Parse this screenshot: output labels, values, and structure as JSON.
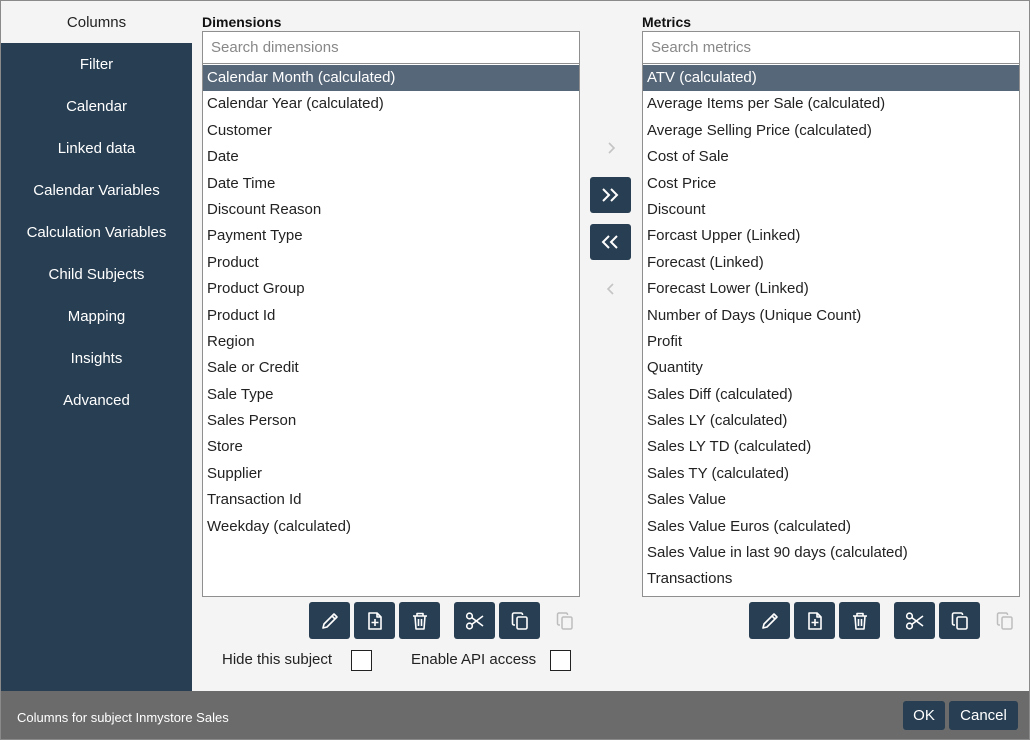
{
  "sidebar": {
    "items": [
      {
        "label": "Columns",
        "active": true
      },
      {
        "label": "Filter"
      },
      {
        "label": "Calendar"
      },
      {
        "label": "Linked data"
      },
      {
        "label": "Calendar Variables"
      },
      {
        "label": "Calculation Variables"
      },
      {
        "label": "Child Subjects"
      },
      {
        "label": "Mapping"
      },
      {
        "label": "Insights"
      },
      {
        "label": "Advanced"
      }
    ]
  },
  "dimensions": {
    "title": "Dimensions",
    "search_placeholder": "Search dimensions",
    "items": [
      "Calendar Month (calculated)",
      "Calendar Year (calculated)",
      "Customer",
      "Date",
      "Date Time",
      "Discount Reason",
      "Payment Type",
      "Product",
      "Product Group",
      "Product Id",
      "Region",
      "Sale or Credit",
      "Sale Type",
      "Sales Person",
      "Store",
      "Supplier",
      "Transaction Id",
      "Weekday (calculated)"
    ],
    "selected_index": 0
  },
  "metrics": {
    "title": "Metrics",
    "search_placeholder": "Search metrics",
    "items": [
      "ATV (calculated)",
      "Average Items per Sale (calculated)",
      "Average Selling Price (calculated)",
      "Cost of Sale",
      "Cost Price",
      "Discount",
      "Forcast Upper (Linked)",
      "Forecast (Linked)",
      "Forecast Lower (Linked)",
      "Number of Days (Unique Count)",
      "Profit",
      "Quantity",
      "Sales Diff (calculated)",
      "Sales LY (calculated)",
      "Sales LY TD (calculated)",
      "Sales TY (calculated)",
      "Sales Value",
      "Sales Value Euros (calculated)",
      "Sales Value in last 90 days (calculated)",
      "Transactions"
    ],
    "selected_index": 0
  },
  "transfer_icons": [
    "chevron-right-icon",
    "double-chevron-right-icon",
    "double-chevron-left-icon",
    "chevron-left-icon"
  ],
  "toolbar_icons": [
    "pencil-icon",
    "file-plus-icon",
    "trash-icon",
    "scissors-icon",
    "copy-icon",
    "paste-icon"
  ],
  "options": {
    "hide_subject_label": "Hide this subject",
    "hide_subject_checked": false,
    "api_access_label": "Enable API access",
    "api_access_checked": false
  },
  "footer": {
    "status": "Columns for subject Inmystore Sales",
    "ok_label": "OK",
    "cancel_label": "Cancel"
  },
  "colors": {
    "navy": "#283e52",
    "selected": "#566779",
    "footer": "#6b6b6b"
  }
}
